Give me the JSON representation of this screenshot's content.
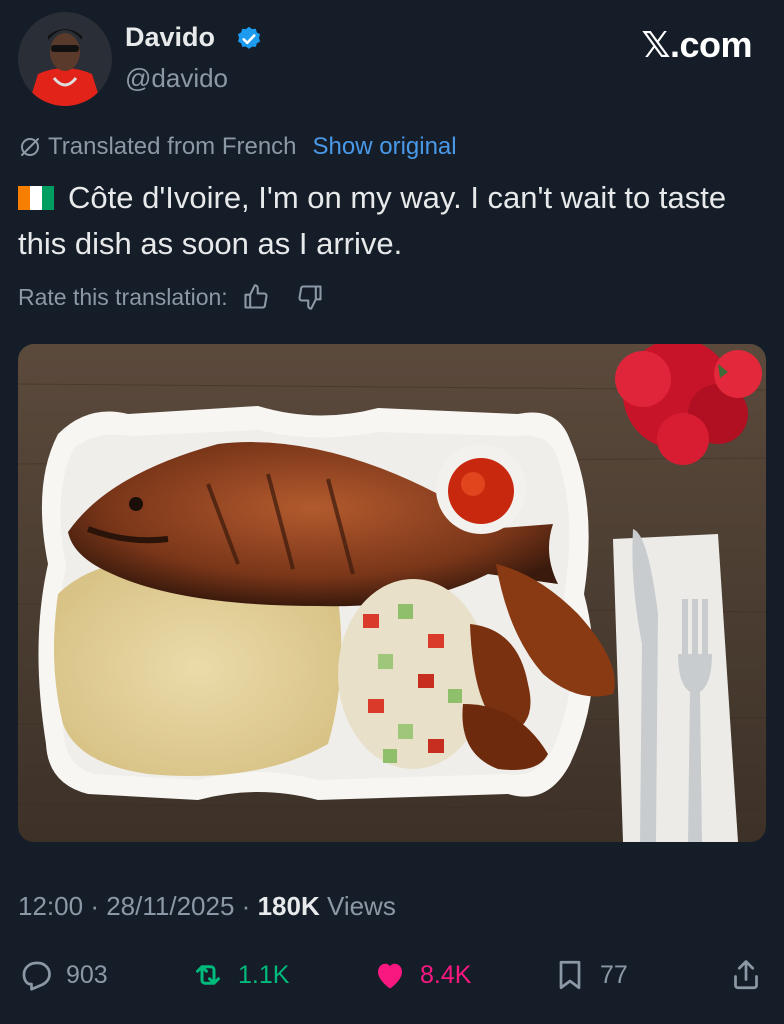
{
  "author": {
    "display_name": "Davido",
    "handle": "@davido",
    "verified": true,
    "avatar_icon": "avatar-photo"
  },
  "site_logo": "𝕏.com",
  "translation": {
    "label": "Translated from French",
    "show_original": "Show original",
    "icon": "globe-strike-icon"
  },
  "tweet": {
    "flag": "cote-divoire-flag",
    "text": "Côte d'Ivoire, I'm on my way. I can't wait to taste this dish as soon as I arrive."
  },
  "rate": {
    "label": "Rate this translation:",
    "up_icon": "thumbs-up-icon",
    "down_icon": "thumbs-down-icon"
  },
  "media": {
    "icon": "food-photo"
  },
  "meta": {
    "time": "12:00",
    "date": "28/11/2025",
    "views_count": "180K",
    "views_label": "Views",
    "separator": "·"
  },
  "actions": {
    "replies": "903",
    "reposts": "1.1K",
    "likes": "8.4K",
    "bookmarks": "77"
  },
  "colors": {
    "background": "#151d28",
    "accent_link": "#4a99e9",
    "repost": "#00ba7c",
    "like": "#f91880",
    "muted": "#8b98a5"
  }
}
